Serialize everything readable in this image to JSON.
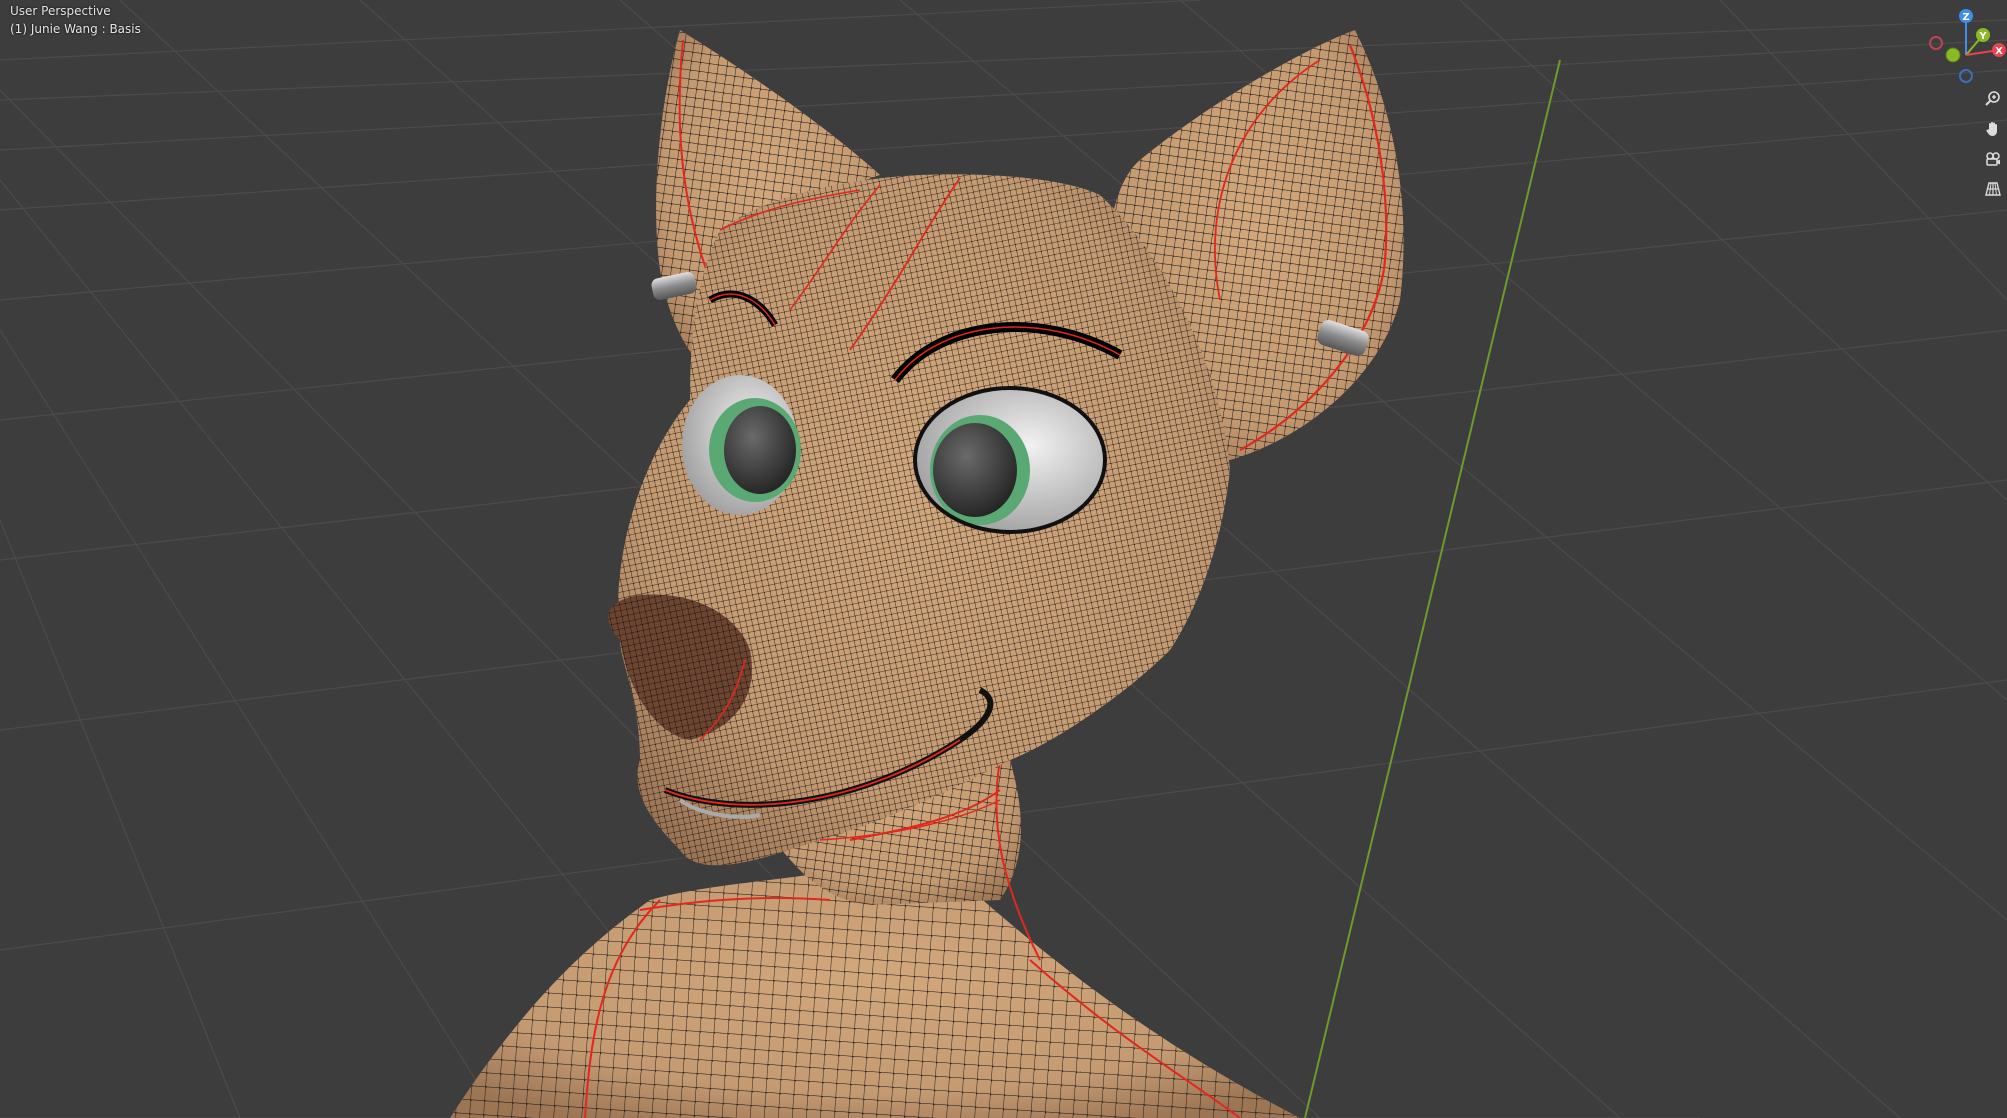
{
  "viewport": {
    "view_mode": "User Perspective",
    "object_info": "(1) Junie Wang : Basis",
    "background_color": "#3d3d3d",
    "grid_color": "#4c4c4c",
    "y_axis_color": "#6f9a2a"
  },
  "gizmo": {
    "z_label": "Z",
    "y_label": "Y",
    "x_label": "X",
    "z_color": "#3d8ef0",
    "y_color": "#8ab826",
    "x_color": "#e8434f"
  },
  "navigation": {
    "buttons": [
      {
        "name": "zoom-icon"
      },
      {
        "name": "pan-hand-icon"
      },
      {
        "name": "camera-view-icon"
      },
      {
        "name": "perspective-grid-icon"
      }
    ]
  },
  "model": {
    "skin_color": "#c49a72",
    "wire_color": "#111111",
    "seam_color": "#e0281e",
    "eye_iris_color": "#5aa874",
    "eye_pupil_color": "#333333",
    "earring_color": "#9a9a9a"
  }
}
